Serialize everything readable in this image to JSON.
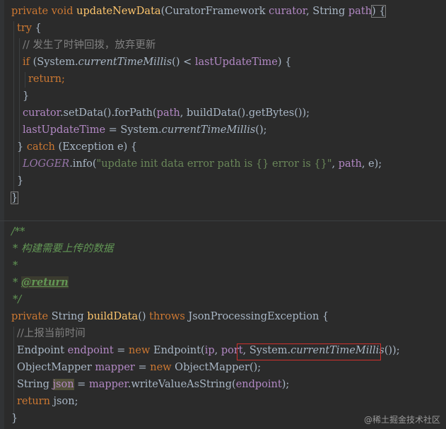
{
  "editor": {
    "method1": {
      "l1": {
        "a": "private",
        "b": " ",
        "c": "void",
        "d": " ",
        "e": "updateNewData",
        "f": "(CuratorFramework ",
        "g": "curator",
        ",": ", String ",
        "h": "path",
        "i": ") {"
      },
      "l2": {
        "a": "try",
        "b": " {"
      },
      "l3": {
        "a": "// 发生了时钟回拨，放弃更新"
      },
      "l4": {
        "a": "if",
        "b": " (System.",
        "c": "currentTimeMillis",
        "d": "() < ",
        "e": "lastUpdateTime",
        "f": ") {"
      },
      "l5": {
        "a": "return",
        "b": ";"
      },
      "l6": {
        "a": "}"
      },
      "l7": {
        "a": "curator",
        ".": ".setData().forPath(",
        "b": "path",
        "c": ", buildData().getBytes());"
      },
      "l8": {
        "a": "lastUpdateTime",
        "b": " = System.",
        "c": "currentTimeMillis",
        "d": "();"
      },
      "l9": {
        "a": "} ",
        "b": "catch",
        "c": " (Exception e) {"
      },
      "l10": {
        "a": "LOGGER",
        ".": ".info(",
        "b": "\"update init data error path is {} error is {}\"",
        "c": ", ",
        "d": "path",
        "e": ", e);"
      },
      "l11": {
        "a": "}"
      },
      "l12": {
        "a": "}"
      }
    },
    "method2": {
      "l13": {
        "a": "/**"
      },
      "l14": {
        "a": "* 构建需要上传的数据"
      },
      "l15": {
        "a": "*"
      },
      "l16": {
        "a": "* ",
        "b": "@return"
      },
      "l17": {
        "a": "*/"
      },
      "l18": {
        "a": "private",
        "b": " String ",
        "c": "buildData",
        "d": "() ",
        "e": "throws",
        "f": " JsonProcessingException {"
      },
      "l19": {
        "a": "//上报当前时间"
      },
      "l20": {
        "a": "Endpoint ",
        "b": "endpoint",
        "c": " = ",
        "d": "new",
        "e": " Endpoint(",
        "f": "ip",
        ",": ", ",
        "g": "port",
        ",2": ", ",
        "h": "System.",
        "i": "currentTimeMillis",
        "j": "());"
      },
      "l21": {
        "a": "ObjectMapper ",
        "b": "mapper",
        "c": " = ",
        "d": "new",
        "e": " ObjectMapper();"
      },
      "l22": {
        "a": "String ",
        "b": "json",
        "c": " = ",
        "d": "mapper",
        ".": ".writeValueAsString(",
        "e": "endpoint",
        "f": ");"
      },
      "l23": {
        "a": "return",
        "b": " json;"
      },
      "l24": {
        "a": "}"
      }
    }
  },
  "watermark": "@稀土掘金技术社区",
  "colors": {
    "background": "#2b2b2b",
    "keyword": "#cc7832",
    "function": "#ffc66d",
    "field": "#b389c5",
    "string": "#6a8759",
    "comment": "#808080",
    "doc": "#629755",
    "highlight_box": "#d0312d"
  }
}
